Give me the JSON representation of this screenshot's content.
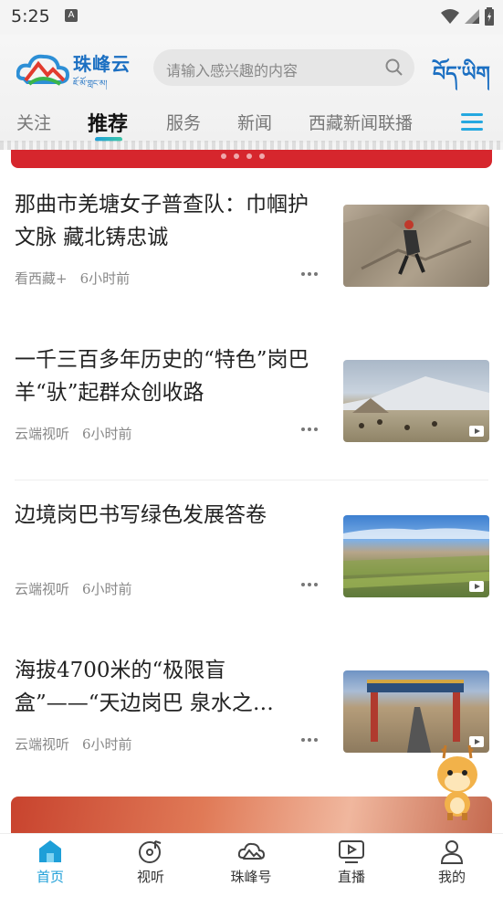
{
  "status": {
    "time": "5:25",
    "notif": "A"
  },
  "header": {
    "logo_text": "珠峰云",
    "logo_sub": "ཇོ་མོ་གླང་མ།",
    "search_placeholder": "请输入感兴趣的内容",
    "tibetan_link": "བོད་ཡིག"
  },
  "tabs": [
    {
      "label": "关注"
    },
    {
      "label": "推荐"
    },
    {
      "label": "服务"
    },
    {
      "label": "新闻"
    },
    {
      "label": "西藏新闻联播"
    }
  ],
  "active_tab": "推荐",
  "news": [
    {
      "title": "那曲市羌塘女子普查队：巾帼护文脉 藏北铸忠诚",
      "source": "看西藏+",
      "time": "6小时前",
      "video": false
    },
    {
      "title": "一千三百多年历史的“特色”岗巴羊“驮”起群众创收路",
      "source": "云端视听",
      "time": "6小时前",
      "video": true
    },
    {
      "title": "边境岗巴书写绿色发展答卷",
      "source": "云端视听",
      "time": "6小时前",
      "video": true
    },
    {
      "title": "海拔4700米的“极限盲盒”——“天边岗巴 泉水之…",
      "source": "云端视听",
      "time": "6小时前",
      "video": true
    }
  ],
  "nav": [
    {
      "label": "首页",
      "icon": "home-icon",
      "active": true
    },
    {
      "label": "视听",
      "icon": "music-disc-icon",
      "active": false
    },
    {
      "label": "珠峰号",
      "icon": "cloud-logo-icon",
      "active": false
    },
    {
      "label": "直播",
      "icon": "play-screen-icon",
      "active": false
    },
    {
      "label": "我的",
      "icon": "user-icon",
      "active": false
    }
  ],
  "colors": {
    "accent": "#1e9fd8",
    "banner_red": "#d6262d"
  }
}
